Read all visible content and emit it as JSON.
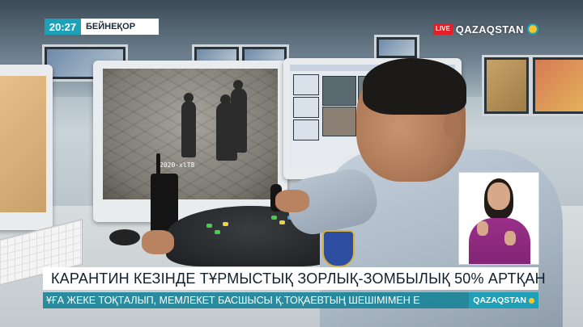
{
  "broadcast": {
    "clock": "20:27",
    "location": "БЕЙНЕҚОР",
    "live_label": "LIVE",
    "channel_name": "QAZAQSTAN",
    "headline": "КАРАНТИН КЕЗІНДЕ ТҰРМЫСТЫҚ ЗОРЛЫҚ-ЗОМБЫЛЫҚ 50% АРТҚАН",
    "ticker_text": "ҰҒА ЖЕКЕ ТОҚТАЛЫП, МЕМЛЕКЕТ БАСШЫСЫ Қ.ТОҚАЕВТЫҢ ШЕШІМІМЕН Е",
    "ticker_channel_name": "QAZAQSTAN"
  },
  "cctv": {
    "osd_text": "2020-xlT8"
  },
  "colors": {
    "accent": "#1ea1b8",
    "live_red": "#e41e26",
    "headline_bg": "#ffffff",
    "signer_outfit": "#9a2f8a"
  },
  "icons": {
    "channel_logo": "sun-circle-icon",
    "ticker_logo": "sun-circle-icon"
  }
}
